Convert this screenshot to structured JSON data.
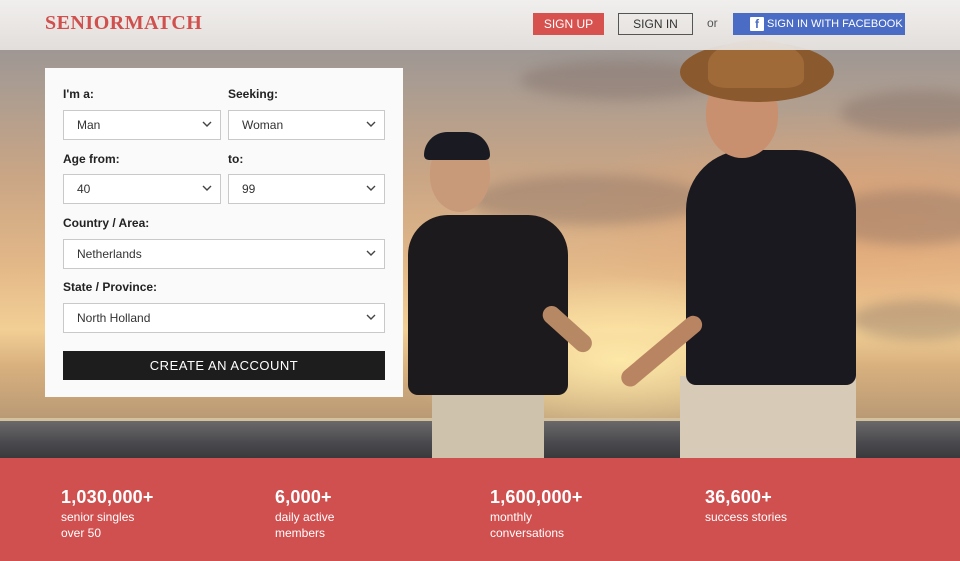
{
  "header": {
    "logo": "SENIORMATCH",
    "signup_label": "SIGN UP",
    "signin_label": "SIGN IN",
    "or_text": "or",
    "facebook_label": "SIGN IN WITH FACEBOOK",
    "facebook_icon": "facebook-icon"
  },
  "form": {
    "im_a": {
      "label": "I'm a:",
      "value": "Man"
    },
    "seeking": {
      "label": "Seeking:",
      "value": "Woman"
    },
    "age_from": {
      "label": "Age from:",
      "value": "40"
    },
    "age_to": {
      "label": "to:",
      "value": "99"
    },
    "country": {
      "label": "Country / Area:",
      "value": "Netherlands"
    },
    "state": {
      "label": "State / Province:",
      "value": "North Holland"
    },
    "submit_label": "CREATE AN ACCOUNT"
  },
  "stats": [
    {
      "number": "1,030,000+",
      "desc": "senior singles\nover 50"
    },
    {
      "number": "6,000+",
      "desc": "daily active\nmembers"
    },
    {
      "number": "1,600,000+",
      "desc": "monthly\nconversations"
    },
    {
      "number": "36,600+",
      "desc": "success stories"
    }
  ],
  "colors": {
    "brand": "#d0504e",
    "facebook": "#4a6cc4",
    "button_dark": "#1d1d1d"
  }
}
